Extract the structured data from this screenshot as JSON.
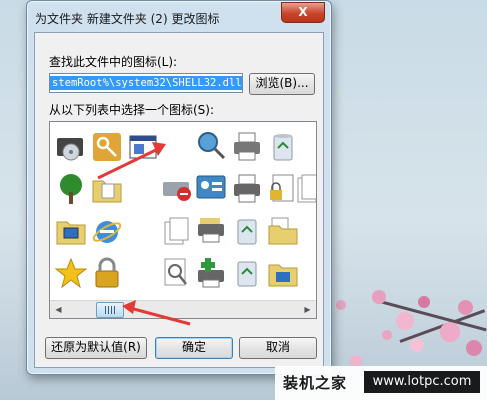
{
  "dialog": {
    "title": "为文件夹 新建文件夹 (2) 更改图标",
    "close_label": "X",
    "find_label": "查找此文件中的图标(L):",
    "path_value": "stemRoot%\\system32\\SHELL32.dll",
    "browse_label": "浏览(B)...",
    "select_label": "从以下列表中选择一个图标(S):",
    "restore_label": "还原为默认值(R)",
    "ok_label": "确定",
    "cancel_label": "取消"
  },
  "icons": [
    "optical-drive-icon",
    "key-icon",
    "program-window-icon",
    "network-search-icon",
    "printer-icon",
    "recycle-bin-icon",
    "network-tree-icon",
    "folder-file-icon",
    "hard-drive-error-icon",
    "control-panel-icon",
    "printer-icon",
    "locked-file-icon",
    "documents-icon",
    "sync-icon",
    "my-computer-folder-icon",
    "internet-explorer-icon",
    "documents-stack-icon",
    "network-printer-icon",
    "recycle-bin-full-icon",
    "folder-files-icon",
    "star-icon",
    "padlock-icon",
    "search-document-icon",
    "printer-add-icon",
    "recycle-bin-empty-icon",
    "folder-network-icon"
  ],
  "scrollbar": {
    "left_arrow": "◀",
    "right_arrow": "▶"
  },
  "watermark": {
    "site_name": "装机之家",
    "url": "www.lotpc.com"
  },
  "colors": {
    "accent": "#3399ff",
    "close": "#c8452b",
    "annotation": "#e53935"
  }
}
